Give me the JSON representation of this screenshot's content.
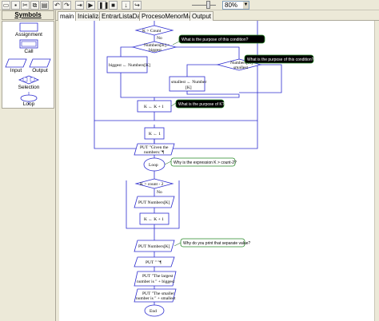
{
  "toolbar": {
    "zoom": "80%",
    "icons": [
      "open-icon",
      "save-icon",
      "cut-icon",
      "copy-icon",
      "paste-icon",
      "undo-icon",
      "redo-icon",
      "step-icon",
      "play-icon",
      "pause-icon",
      "stop-icon",
      "step-into-icon",
      "step-over-icon"
    ]
  },
  "symbols": {
    "header": "Symbols",
    "items": [
      "Assignment",
      "Call",
      "Input",
      "Output",
      "Selection",
      "Loop"
    ]
  },
  "tabs": [
    "main",
    "Inicializar",
    "EntrarListaDatos",
    "ProcesoMenorMayor",
    "Output"
  ],
  "flowchart": {
    "cond_k_count": "K > Count",
    "no_1": "No",
    "cond_numbers_biggest_1": "Numbers[K] >",
    "cond_numbers_biggest_2": "biggest",
    "assign_biggest": "biggest ← Numbers[K]",
    "cond_numbers_smallest_1": "Numbers[K] <",
    "cond_numbers_smallest_2": "smallest",
    "assign_smallest_1": "smallest ← Number",
    "assign_smallest_2": "[K]",
    "assign_k_inc_top": "K ← K + 1",
    "assign_k_1": "K ← 1",
    "put_given_1": "PUT \"Given the",
    "put_given_2": "numbers:\"¶",
    "loop_label": "Loop",
    "cond_k_count2": "K > count - 2",
    "no_2": "No",
    "put_numbers_k_loop": "PUT Numbers[K]",
    "assign_k_inc_bottom": "K ← K + 1",
    "put_numbers_k": "PUT Numbers[K]",
    "put_empty": "PUT \" \"¶",
    "put_largest_1": "PUT \"The largest",
    "put_largest_2": "number is \" + biggest",
    "put_smaller_1": "PUT \"The smaller",
    "put_smaller_2": "number is \" + smallest",
    "end_label": "End"
  },
  "comments": [
    "What is the purpose of this condition?",
    "What is the purpose of this condition?",
    "What is the purpose of K?",
    "Why is the expression K > count-2?",
    "Why do you print that separate value?"
  ]
}
